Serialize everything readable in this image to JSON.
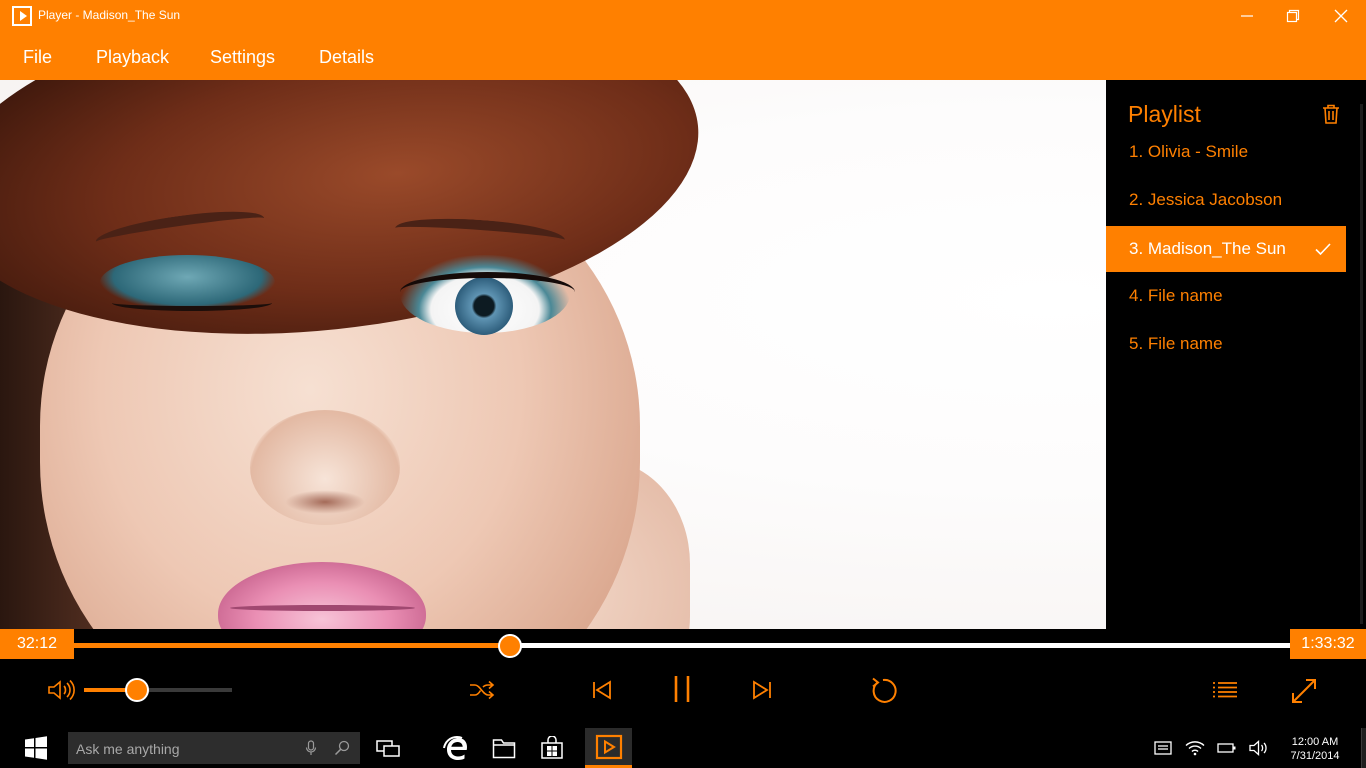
{
  "window": {
    "title": "Player - Madison_The Sun"
  },
  "menu": {
    "items": [
      {
        "label": "File"
      },
      {
        "label": "Playback"
      },
      {
        "label": "Settings"
      },
      {
        "label": "Details"
      }
    ]
  },
  "playlist": {
    "title": "Playlist",
    "items": [
      {
        "label": "1. Olivia - Smile",
        "active": false
      },
      {
        "label": "2. Jessica  Jacobson",
        "active": false
      },
      {
        "label": "3. Madison_The Sun",
        "active": true
      },
      {
        "label": "4. File name",
        "active": false
      },
      {
        "label": "5. File name",
        "active": false
      }
    ]
  },
  "seek": {
    "current_time": "32:12",
    "total_time": "1:33:32",
    "progress": 0.3585
  },
  "volume": {
    "level": 0.36
  },
  "taskbar": {
    "search_placeholder": "Ask me anything",
    "time": "12:00 AM",
    "date": "7/31/2014"
  },
  "colors": {
    "accent": "#ff8000",
    "background": "#000000",
    "text_on_accent": "#ffffff"
  },
  "icons": [
    "app-icon",
    "minimize-icon",
    "restore-icon",
    "close-icon",
    "trash-icon",
    "check-icon",
    "volume-icon",
    "shuffle-icon",
    "previous-icon",
    "pause-icon",
    "next-icon",
    "repeat-icon",
    "playlist-icon",
    "fullscreen-icon",
    "windows-icon",
    "microphone-icon",
    "search-icon",
    "task-view-icon",
    "edge-icon",
    "file-explorer-icon",
    "store-icon",
    "player-taskbar-icon",
    "notifications-icon",
    "wifi-icon",
    "battery-icon",
    "speaker-icon"
  ]
}
